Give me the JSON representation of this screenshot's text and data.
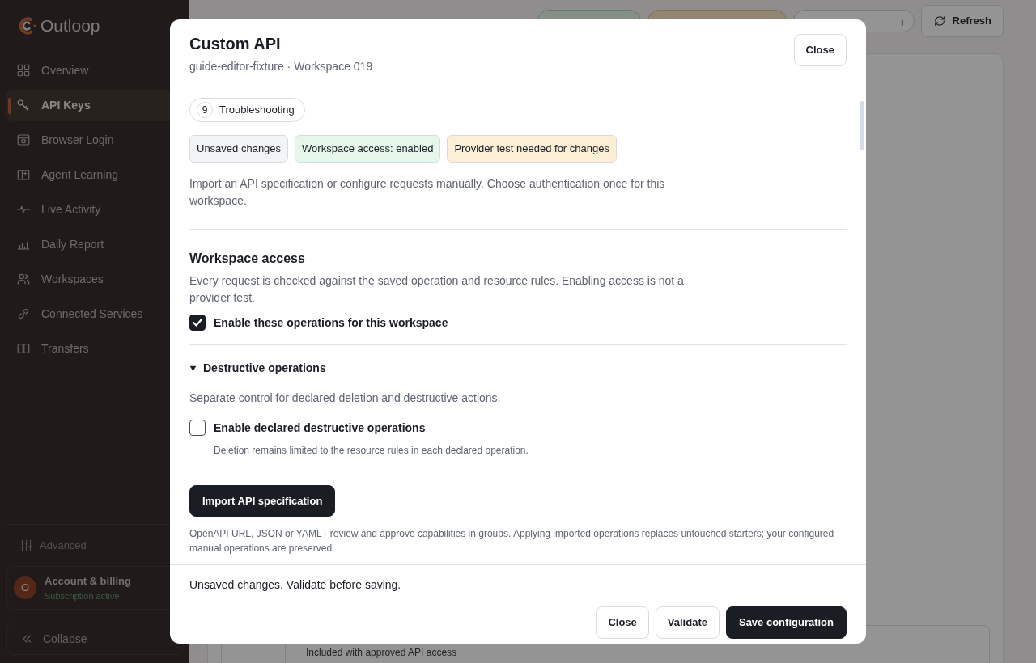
{
  "sidebar": {
    "brand": "Outloop",
    "items": [
      {
        "label": "Overview",
        "selected": false
      },
      {
        "label": "API Keys",
        "selected": true
      },
      {
        "label": "Browser Login",
        "selected": false
      },
      {
        "label": "Agent Learning",
        "selected": false
      },
      {
        "label": "Live Activity",
        "selected": false
      },
      {
        "label": "Daily Report",
        "selected": false
      },
      {
        "label": "Workspaces",
        "selected": false
      },
      {
        "label": "Connected Services",
        "selected": false
      },
      {
        "label": "Transfers",
        "selected": false
      }
    ],
    "advanced": "Advanced",
    "account": {
      "avatar": "O",
      "name": "Account & billing",
      "status": "Subscription active"
    },
    "collapse": "Collapse"
  },
  "page": {
    "info": "i",
    "refresh": "Refresh",
    "card_note": "Included with approved API access"
  },
  "modal": {
    "title": "Custom API",
    "subtitle": "guide-editor-fixture · Workspace 019",
    "close": "Close",
    "step": {
      "number": "9",
      "label": "Troubleshooting"
    },
    "tags": [
      {
        "label": "Unsaved changes",
        "color": "#f3f4f6"
      },
      {
        "label": "Workspace access: enabled",
        "color": "#e5f6eb"
      },
      {
        "label": "Provider test needed for changes",
        "color": "#fdefd6"
      }
    ],
    "intro": "Import an API specification or configure requests manually. Choose authentication once for this workspace.",
    "access": {
      "heading": "Workspace access",
      "description": "Every request is checked against the saved operation and resource rules. Enabling access is not a provider test.",
      "checkbox": {
        "label": "Enable these operations for this workspace",
        "checked": true
      }
    },
    "destructive": {
      "summary": "Destructive operations",
      "expanded": true,
      "description": "Separate control for declared deletion and destructive actions.",
      "checkbox": {
        "label": "Enable declared destructive operations",
        "checked": false,
        "hint": "Deletion remains limited to the resource rules in each declared operation."
      }
    },
    "import_button": "Import API specification",
    "import_note": "OpenAPI URL, JSON or YAML · review and approve capabilities in groups. Applying imported operations replaces untouched starters; your configured manual operations are preserved.",
    "footer_status": "Unsaved changes. Validate before saving.",
    "buttons": [
      {
        "label": "Close",
        "kind": "outline"
      },
      {
        "label": "Validate",
        "kind": "outline"
      },
      {
        "label": "Save configuration",
        "kind": "primary"
      }
    ]
  }
}
